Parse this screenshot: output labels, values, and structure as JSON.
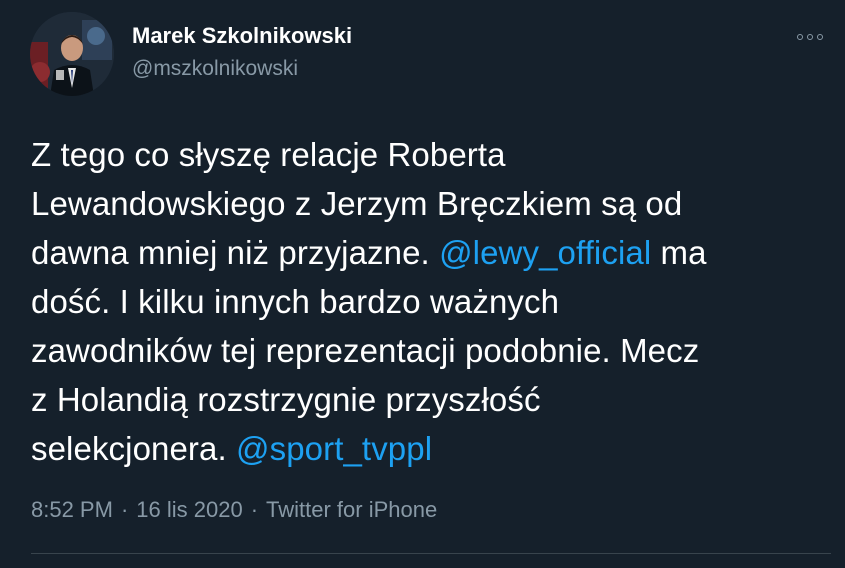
{
  "author": {
    "name": "Marek Szkolnikowski",
    "handle": "@mszkolnikowski"
  },
  "more_icon": "more-horizontal-icon",
  "tweet": {
    "lines": [
      {
        "segments": [
          {
            "text": "Z tego co słyszę relacje Roberta",
            "type": "text"
          }
        ]
      },
      {
        "segments": [
          {
            "text": "Lewandowskiego z Jerzym Bręczkiem są od",
            "type": "text"
          }
        ]
      },
      {
        "segments": [
          {
            "text": "dawna mniej niż przyjazne. ",
            "type": "text"
          },
          {
            "text": "@lewy_official",
            "type": "mention"
          },
          {
            "text": " ma",
            "type": "text"
          }
        ]
      },
      {
        "segments": [
          {
            "text": "dość. I kilku innych bardzo ważnych",
            "type": "text"
          }
        ]
      },
      {
        "segments": [
          {
            "text": "zawodników tej reprezentacji podobnie. Mecz",
            "type": "text"
          }
        ]
      },
      {
        "segments": [
          {
            "text": "z Holandią rozstrzygnie przyszłość",
            "type": "text"
          }
        ]
      },
      {
        "segments": [
          {
            "text": "selekcjonera. ",
            "type": "text"
          },
          {
            "text": "@sport_tvppl",
            "type": "mention"
          }
        ]
      }
    ]
  },
  "meta": {
    "time": "8:52 PM",
    "date": "16 lis 2020",
    "source": "Twitter for iPhone",
    "separator": "·"
  },
  "colors": {
    "background": "#15202b",
    "text": "#ffffff",
    "secondary": "#8899a6",
    "link": "#1da1f2",
    "divider": "#38444d"
  }
}
